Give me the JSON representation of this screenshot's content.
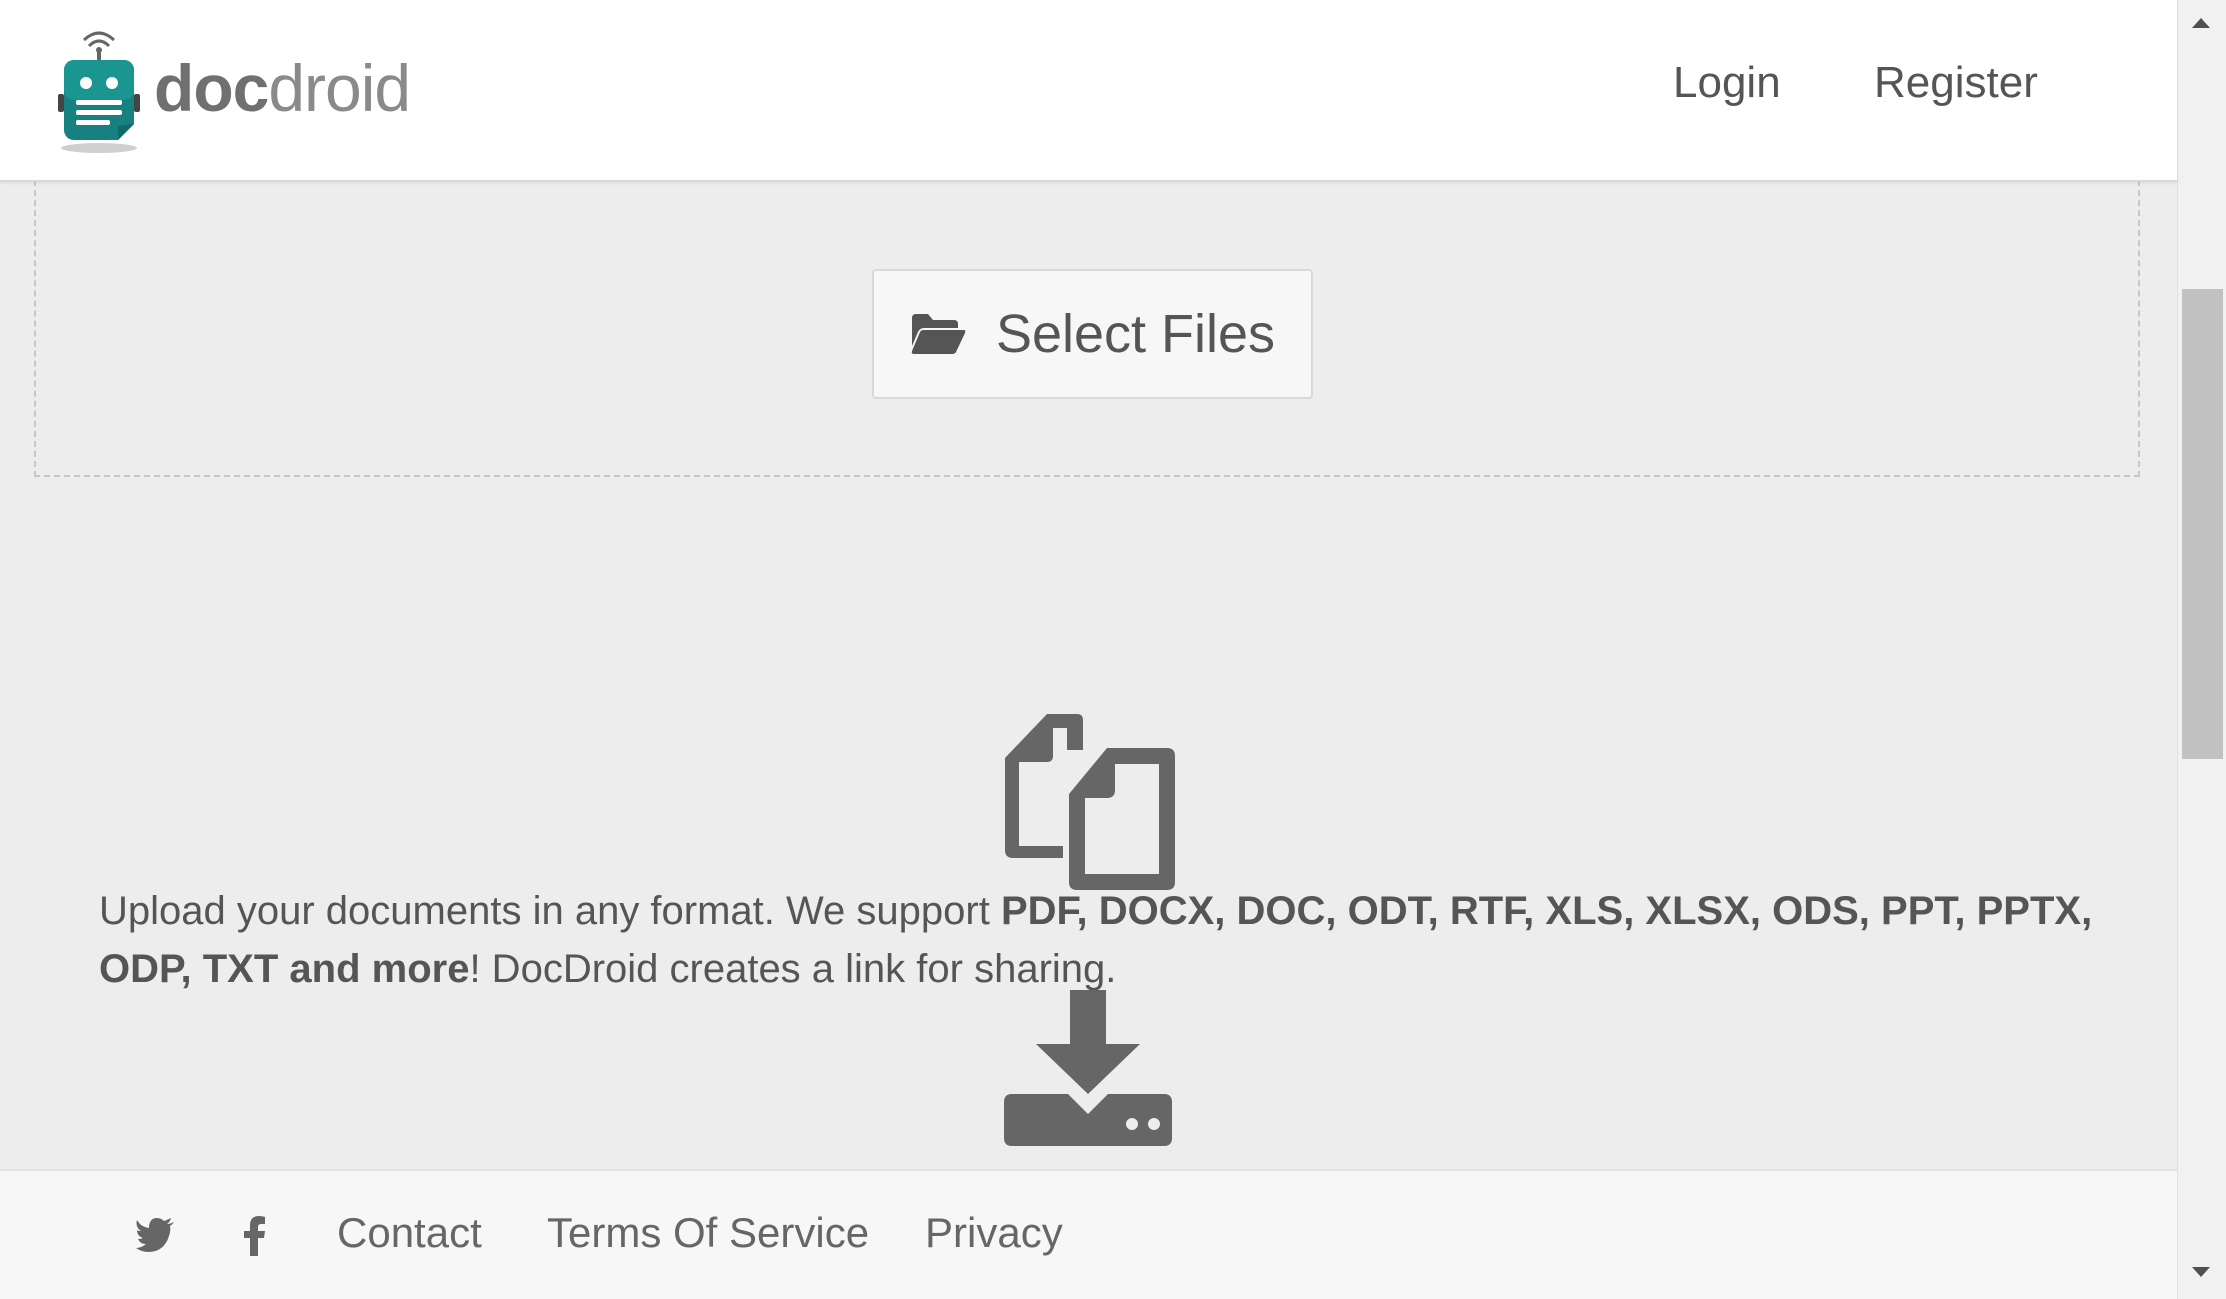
{
  "header": {
    "logo_bold": "doc",
    "logo_light": "droid",
    "nav": {
      "login": "Login",
      "register": "Register"
    }
  },
  "upload": {
    "select_files_label": "Select Files"
  },
  "description": {
    "intro": "Upload your documents in any format. We support ",
    "formats": "PDF, DOCX, DOC, ODT, RTF, XLS, XLSX, ODS, PPT, PPTX, ODP, TXT and more",
    "outro": "! DocDroid creates a link for sharing."
  },
  "footer": {
    "contact": "Contact",
    "terms": "Terms Of Service",
    "privacy": "Privacy"
  },
  "colors": {
    "brand_teal": "#16817e",
    "text": "#555555",
    "icon_gray": "#666666",
    "background": "#ededed"
  },
  "icons": {
    "logo": "robot-document-icon",
    "select_files": "folder-open-icon",
    "copy": "copy-files-icon",
    "download": "download-tray-icon",
    "twitter": "twitter-icon",
    "facebook": "facebook-icon"
  }
}
